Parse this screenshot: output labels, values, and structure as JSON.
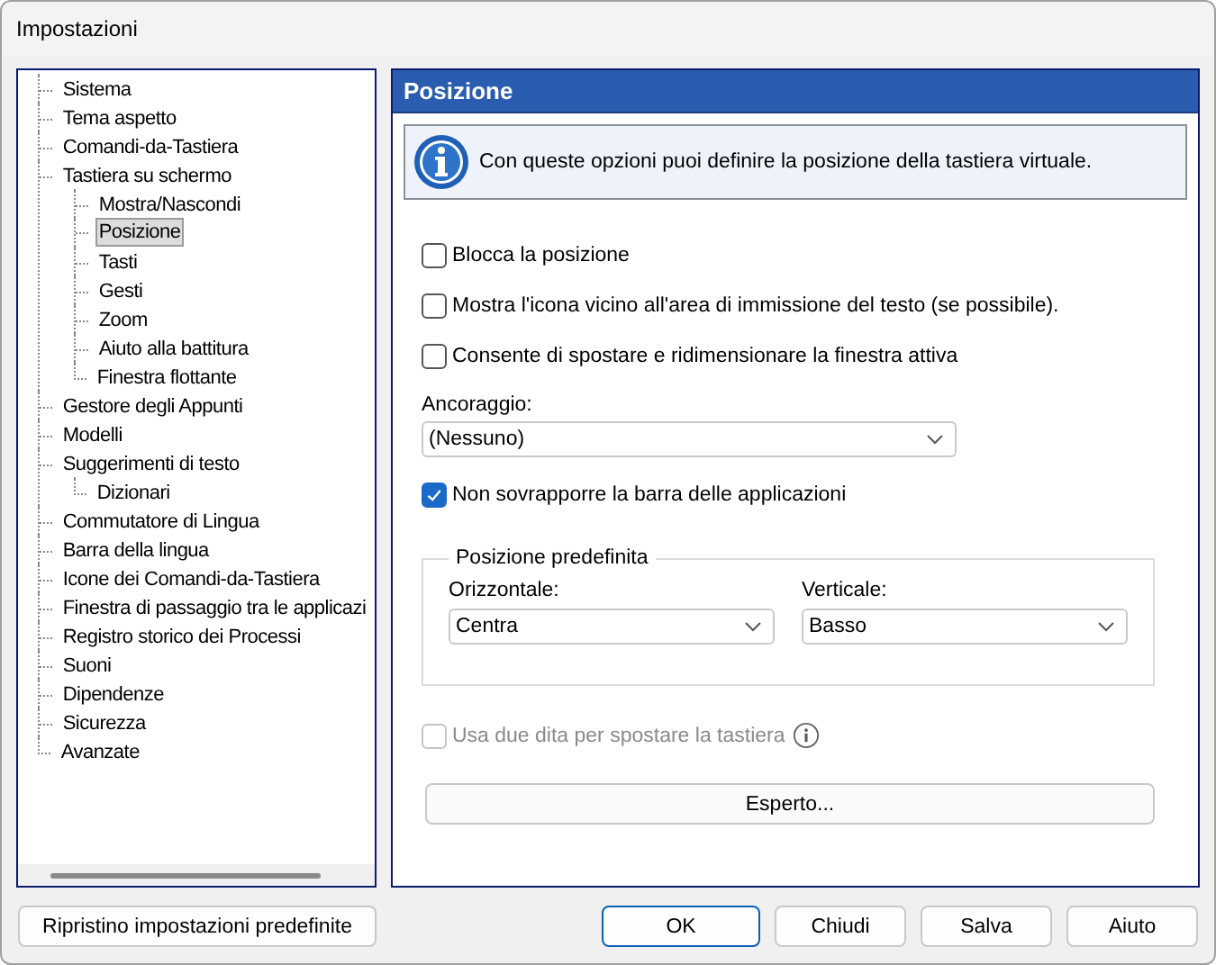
{
  "window": {
    "title": "Impostazioni"
  },
  "tree": [
    {
      "label": "Sistema",
      "selected": false
    },
    {
      "label": "Tema aspetto",
      "selected": false
    },
    {
      "label": "Comandi-da-Tastiera",
      "selected": false
    },
    {
      "label": "Tastiera su schermo",
      "selected": false,
      "children": [
        {
          "label": "Mostra/Nascondi",
          "selected": false
        },
        {
          "label": "Posizione",
          "selected": true
        },
        {
          "label": "Tasti",
          "selected": false
        },
        {
          "label": "Gesti",
          "selected": false
        },
        {
          "label": "Zoom",
          "selected": false
        },
        {
          "label": "Aiuto alla battitura",
          "selected": false
        },
        {
          "label": "Finestra flottante",
          "selected": false
        }
      ]
    },
    {
      "label": "Gestore degli Appunti",
      "selected": false
    },
    {
      "label": "Modelli",
      "selected": false
    },
    {
      "label": "Suggerimenti di testo",
      "selected": false,
      "children": [
        {
          "label": "Dizionari",
          "selected": false
        }
      ]
    },
    {
      "label": "Commutatore di Lingua",
      "selected": false
    },
    {
      "label": "Barra della lingua",
      "selected": false
    },
    {
      "label": "Icone dei Comandi-da-Tastiera",
      "selected": false
    },
    {
      "label": "Finestra di passaggio tra le applicazi",
      "selected": false
    },
    {
      "label": "Registro storico dei Processi",
      "selected": false
    },
    {
      "label": "Suoni",
      "selected": false
    },
    {
      "label": "Dipendenze",
      "selected": false
    },
    {
      "label": "Sicurezza",
      "selected": false
    },
    {
      "label": "Avanzate",
      "selected": false
    }
  ],
  "panel": {
    "title": "Posizione",
    "info": "Con queste opzioni puoi definire la posizione della tastiera virtuale.",
    "options": [
      {
        "label": "Blocca la posizione",
        "checked": false
      },
      {
        "label": "Mostra l'icona vicino all'area di immissione del testo (se possibile).",
        "checked": false
      },
      {
        "label": "Consente di spostare e ridimensionare la finestra attiva",
        "checked": false
      }
    ],
    "anchor": {
      "label": "Ancoraggio:",
      "value": "(Nessuno)"
    },
    "no_overlap": {
      "label": "Non sovrapporre la barra delle applicazioni",
      "checked": true
    },
    "default_position": {
      "title": "Posizione predefinita",
      "horizontal": {
        "label": "Orizzontale:",
        "value": "Centra"
      },
      "vertical": {
        "label": "Verticale:",
        "value": "Basso"
      }
    },
    "two_fingers": {
      "label": "Usa due dita per spostare la tastiera",
      "checked": false,
      "disabled": true
    },
    "expert_button": "Esperto..."
  },
  "reset_button": "Ripristino impostazioni predefinite",
  "buttons": [
    {
      "label": "OK",
      "default": true
    },
    {
      "label": "Chiudi",
      "default": false
    },
    {
      "label": "Salva",
      "default": false
    },
    {
      "label": "Aiuto",
      "default": false
    }
  ]
}
